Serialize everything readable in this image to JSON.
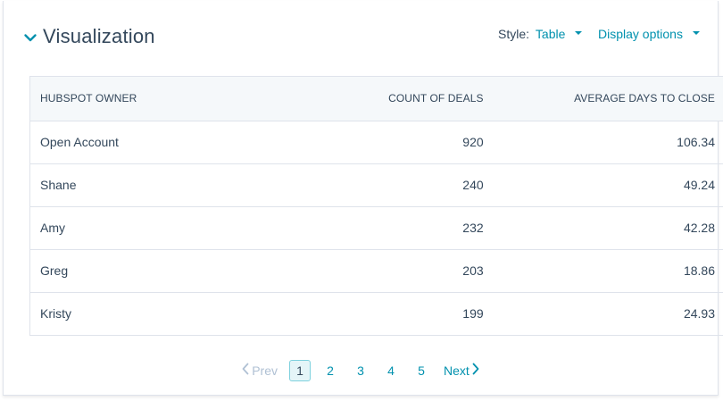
{
  "header": {
    "title": "Visualization",
    "style_label": "Style:",
    "style_value": "Table",
    "display_options": "Display options"
  },
  "table": {
    "columns": [
      "HUBSPOT OWNER",
      "COUNT OF DEALS",
      "AVERAGE DAYS TO CLOSE"
    ],
    "rows": [
      {
        "owner": "Open Account",
        "count": "920",
        "days": "106.34"
      },
      {
        "owner": "Shane",
        "count": "240",
        "days": "49.24"
      },
      {
        "owner": "Amy",
        "count": "232",
        "days": "42.28"
      },
      {
        "owner": "Greg",
        "count": "203",
        "days": "18.86"
      },
      {
        "owner": "Kristy",
        "count": "199",
        "days": "24.93"
      }
    ]
  },
  "pagination": {
    "prev": "Prev",
    "pages": [
      "1",
      "2",
      "3",
      "4",
      "5"
    ],
    "current": "1",
    "next": "Next"
  },
  "colors": {
    "accent": "#0091ae",
    "text": "#33475b",
    "header_bg": "#f5f8fa",
    "border": "#dfe3eb"
  }
}
